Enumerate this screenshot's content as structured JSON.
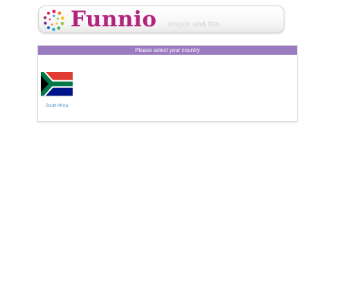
{
  "header": {
    "logo_text": "Funnio",
    "tagline": "simple and fun.",
    "brand_color": "#b3247f"
  },
  "panel": {
    "title": "Please select your country",
    "title_bg": "#9b7bc0",
    "countries": [
      {
        "name": "South Africa",
        "flag_icon": "south-africa-flag-icon"
      }
    ]
  }
}
